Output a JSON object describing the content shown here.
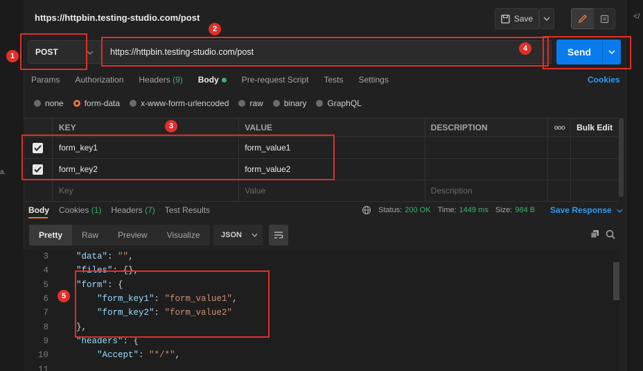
{
  "title": "https://httpbin.testing-studio.com/post",
  "header": {
    "save_label": "Save",
    "pencil_icon": "pencil-icon",
    "doc_icon": "document-icon",
    "side_code_icon": "</"
  },
  "request": {
    "method": "POST",
    "url": "https://httpbin.testing-studio.com/post",
    "send_label": "Send"
  },
  "request_tabs": [
    {
      "label": "Params"
    },
    {
      "label": "Authorization"
    },
    {
      "label": "Headers",
      "count": "(9)"
    },
    {
      "label": "Body"
    },
    {
      "label": "Pre-request Script"
    },
    {
      "label": "Tests"
    },
    {
      "label": "Settings"
    }
  ],
  "cookies_label": "Cookies",
  "body_types": [
    {
      "label": "none"
    },
    {
      "label": "form-data",
      "selected": true
    },
    {
      "label": "x-www-form-urlencoded"
    },
    {
      "label": "raw"
    },
    {
      "label": "binary"
    },
    {
      "label": "GraphQL"
    }
  ],
  "table": {
    "headers": {
      "key": "KEY",
      "value": "VALUE",
      "description": "DESCRIPTION",
      "more": "ooo",
      "bulk_edit": "Bulk Edit"
    },
    "rows": [
      {
        "key": "form_key1",
        "value": "form_value1",
        "checked": true
      },
      {
        "key": "form_key2",
        "value": "form_value2",
        "checked": true
      }
    ],
    "placeholders": {
      "key": "Key",
      "value": "Value",
      "description": "Description"
    }
  },
  "response": {
    "tabs": [
      {
        "label": "Body"
      },
      {
        "label": "Cookies",
        "count": "(1)"
      },
      {
        "label": "Headers",
        "count": "(7)"
      },
      {
        "label": "Test Results"
      }
    ],
    "status_label": "Status:",
    "status_value": "200 OK",
    "time_label": "Time:",
    "time_value": "1449 ms",
    "size_label": "Size:",
    "size_value": "984 B",
    "save_response": "Save Response",
    "view_modes": [
      "Pretty",
      "Raw",
      "Preview",
      "Visualize"
    ],
    "format": "JSON"
  },
  "code_lines": [
    {
      "n": "3",
      "text": "    \"data\": \"\","
    },
    {
      "n": "4",
      "text": "    \"files\": {},"
    },
    {
      "n": "5",
      "text": "    \"form\": {"
    },
    {
      "n": "6",
      "text": "        \"form_key1\": \"form_value1\","
    },
    {
      "n": "7",
      "text": "        \"form_key2\": \"form_value2\""
    },
    {
      "n": "8",
      "text": "    },"
    },
    {
      "n": "9",
      "text": "    \"headers\": {"
    },
    {
      "n": "10",
      "text": "        \"Accept\": \"*/*\","
    },
    {
      "n": "11",
      "text": ""
    }
  ],
  "annotations": [
    "1",
    "2",
    "3",
    "4",
    "5"
  ],
  "colors": {
    "accent": "#097bed",
    "annotation": "#e0302a",
    "success": "#3bb36b",
    "active_tab": "#e8773a"
  }
}
